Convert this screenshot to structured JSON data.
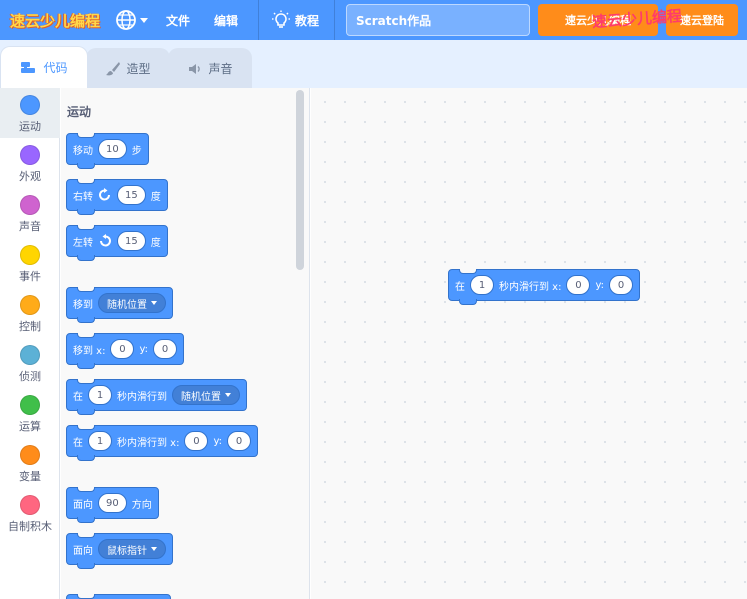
{
  "menubar": {
    "logo_text": "速云少儿编程",
    "file_label": "文件",
    "edit_label": "编辑",
    "tutorial_label": "教程",
    "project_title": "Scratch作品",
    "btn_course": "速云少儿编程",
    "btn_login": "速云登陆",
    "watermark_text": "速云少儿编程",
    "accent_color": "#4c97ff",
    "orange_color": "#ff8c1a"
  },
  "tabs": [
    {
      "label": "代码",
      "icon": "code-icon"
    },
    {
      "label": "造型",
      "icon": "brush-icon"
    },
    {
      "label": "声音",
      "icon": "speaker-icon"
    }
  ],
  "categories": [
    {
      "label": "运动",
      "color": "#4c97ff"
    },
    {
      "label": "外观",
      "color": "#9966ff"
    },
    {
      "label": "声音",
      "color": "#cf63cf"
    },
    {
      "label": "事件",
      "color": "#ffd500"
    },
    {
      "label": "控制",
      "color": "#ffab19"
    },
    {
      "label": "侦测",
      "color": "#5cb1d6"
    },
    {
      "label": "运算",
      "color": "#40bf4a"
    },
    {
      "label": "变量",
      "color": "#ff8c1a"
    },
    {
      "label": "自制积木",
      "color": "#ff6680"
    }
  ],
  "palette": {
    "section_title": "运动",
    "move": {
      "text1": "移动",
      "value": "10",
      "text2": "步"
    },
    "turn_right": {
      "text1": "右转",
      "value": "15",
      "text2": "度"
    },
    "turn_left": {
      "text1": "左转",
      "value": "15",
      "text2": "度"
    },
    "goto": {
      "text1": "移到",
      "dropdown": "随机位置"
    },
    "goto_xy": {
      "text1": "移到 x:",
      "x": "0",
      "text2": "y:",
      "y": "0"
    },
    "glide_to": {
      "text1": "在",
      "value": "1",
      "text2": "秒内滑行到",
      "dropdown": "随机位置"
    },
    "glide_xy": {
      "text1": "在",
      "value": "1",
      "text2": "秒内滑行到 x:",
      "x": "0",
      "text3": "y:",
      "y": "0"
    },
    "point_dir": {
      "text1": "面向",
      "value": "90",
      "text2": "方向"
    },
    "point_towards": {
      "text1": "面向",
      "dropdown": "鼠标指针"
    }
  },
  "workspace": {
    "glide_xy": {
      "text1": "在",
      "value": "1",
      "text2": "秒内滑行到 x:",
      "x": "0",
      "text3": "y:",
      "y": "0"
    }
  }
}
